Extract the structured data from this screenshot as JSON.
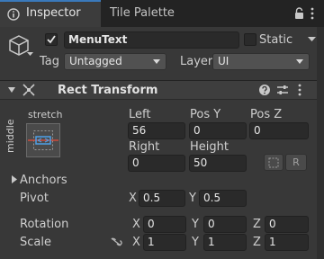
{
  "tabs": [
    {
      "label": "Inspector",
      "active": true
    },
    {
      "label": "Tile Palette",
      "active": false
    }
  ],
  "icons": {
    "inspector_tab": "info-icon",
    "lock": "lock-icon",
    "tab_menu": "vertical-dots-icon",
    "gameobject": "cube-icon",
    "rect_transform": "rect-transform-icon",
    "help": "help-icon",
    "presets": "sliders-icon",
    "component_menu": "vertical-dots-icon",
    "constrain": "link-broken-icon"
  },
  "gameobject": {
    "active": true,
    "name": "MenuText",
    "static_label": "Static",
    "static": false,
    "tag_label": "Tag",
    "tag_value": "Untagged",
    "layer_label": "Layer",
    "layer_value": "UI"
  },
  "rect_transform": {
    "title": "Rect Transform",
    "anchor_preset": {
      "horizontal": "stretch",
      "vertical": "middle"
    },
    "left_label": "Left",
    "left_value": "56",
    "posy_label": "Pos Y",
    "posy_value": "0",
    "posz_label": "Pos Z",
    "posz_value": "0",
    "right_label": "Right",
    "right_value": "0",
    "height_label": "Height",
    "height_value": "50",
    "raw_edit_label": "R",
    "anchors_label": "Anchors",
    "pivot_label": "Pivot",
    "pivot_x_label": "X",
    "pivot_x": "0.5",
    "pivot_y_label": "Y",
    "pivot_y": "0.5",
    "rotation_label": "Rotation",
    "rotation": {
      "x_label": "X",
      "x": "0",
      "y_label": "Y",
      "y": "0",
      "z_label": "Z",
      "z": "0"
    },
    "scale_label": "Scale",
    "scale": {
      "x_label": "X",
      "x": "1",
      "y_label": "Y",
      "y": "1",
      "z_label": "Z",
      "z": "1"
    }
  },
  "colors": {
    "accent": "#3a79bb",
    "anchor_red": "#d04a3a",
    "anchor_blue": "#4ea0e6"
  }
}
